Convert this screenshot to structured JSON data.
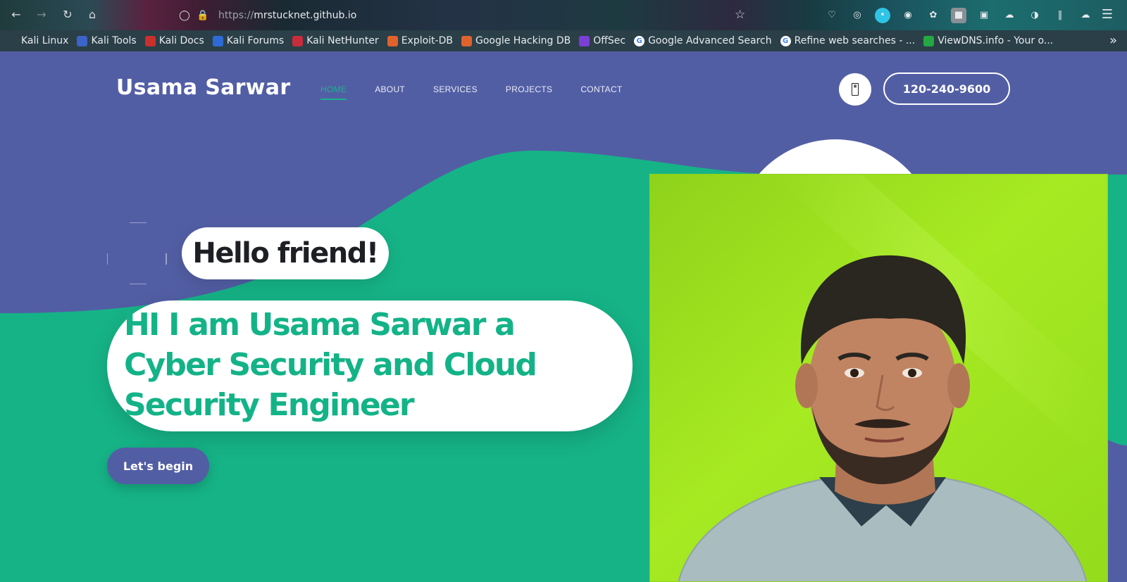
{
  "browser": {
    "url_prefix": "https://",
    "url_host": "mrstucknet.github.io",
    "bookmarks": [
      {
        "label": "Kali Linux",
        "icon": "kali-dragon-icon",
        "color": "#2a3f48"
      },
      {
        "label": "Kali Tools",
        "icon": "kali-tools-icon",
        "color": "#3b63c9"
      },
      {
        "label": "Kali Docs",
        "icon": "kali-docs-icon",
        "color": "#c9302c"
      },
      {
        "label": "Kali Forums",
        "icon": "kali-forums-icon",
        "color": "#2f6bd8"
      },
      {
        "label": "Kali NetHunter",
        "icon": "nethunter-icon",
        "color": "#c92c3a"
      },
      {
        "label": "Exploit-DB",
        "icon": "exploit-db-icon",
        "color": "#e0622c"
      },
      {
        "label": "Google Hacking DB",
        "icon": "ghdb-icon",
        "color": "#e0622c"
      },
      {
        "label": "OffSec",
        "icon": "offsec-icon",
        "color": "#7b3fd6"
      },
      {
        "label": "Google Advanced Search",
        "icon": "google-icon",
        "color": "#ffffff"
      },
      {
        "label": "Refine web searches - ...",
        "icon": "google-icon",
        "color": "#ffffff"
      },
      {
        "label": "ViewDNS.info - Your o...",
        "icon": "viewdns-icon",
        "color": "#23a844"
      }
    ]
  },
  "site": {
    "logo": "Usama Sarwar",
    "nav": [
      "HOME",
      "ABOUT",
      "SERVICES",
      "PROJECTS",
      "CONTACT"
    ],
    "active_nav": "HOME",
    "phone": "120-240-9600",
    "hello": "Hello friend!",
    "headline": "HI I am Usama Sarwar a Cyber Security and Cloud Security Engineer",
    "cta": "Let's begin"
  },
  "colors": {
    "purple": "#525ea4",
    "green": "#16b387",
    "photo_bg": "#9be51f"
  }
}
